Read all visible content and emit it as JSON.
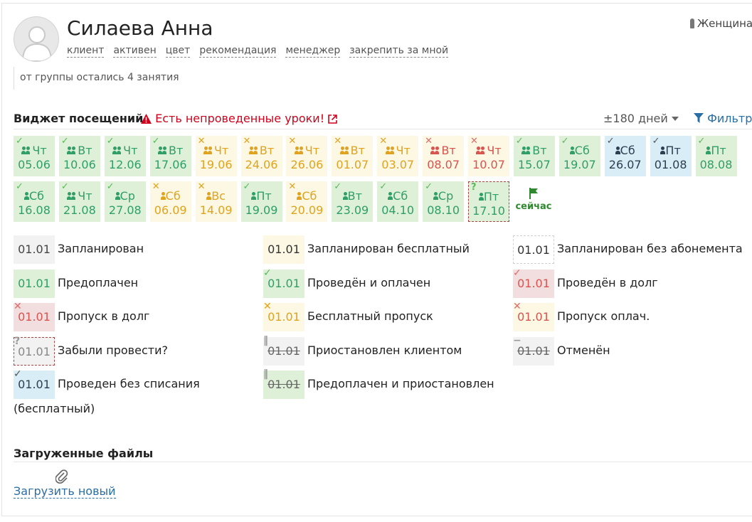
{
  "profile": {
    "name": "Силаева Анна",
    "gender": "Женщина",
    "tags": [
      "клиент",
      "активен",
      "цвет",
      "рекомендация",
      "менеджер",
      "закрепить за мной"
    ],
    "note": "от группы остались 4 занятия"
  },
  "widget": {
    "title": "Виджет посещений",
    "warning": "Есть непроведенные уроки!",
    "range": "±180 дней",
    "filter": "Фильтр"
  },
  "visits": [
    {
      "day": "Чт",
      "date": "05.06",
      "status": "paid",
      "mark": "check",
      "people": 2
    },
    {
      "day": "Вт",
      "date": "10.06",
      "status": "paid",
      "mark": "check",
      "people": 2
    },
    {
      "day": "Чт",
      "date": "12.06",
      "status": "paid",
      "mark": "check",
      "people": 2
    },
    {
      "day": "Вт",
      "date": "17.06",
      "status": "paid",
      "mark": "check",
      "people": 2
    },
    {
      "day": "Чт",
      "date": "19.06",
      "status": "free-skip",
      "mark": "cross",
      "people": 2
    },
    {
      "day": "Вт",
      "date": "24.06",
      "status": "free-skip",
      "mark": "cross",
      "people": 2
    },
    {
      "day": "Чт",
      "date": "26.06",
      "status": "free-skip",
      "mark": "cross",
      "people": 2
    },
    {
      "day": "Вт",
      "date": "01.07",
      "status": "free-skip",
      "mark": "cross",
      "people": 2
    },
    {
      "day": "Чт",
      "date": "03.07",
      "status": "free-skip",
      "mark": "cross",
      "people": 2
    },
    {
      "day": "Вт",
      "date": "08.07",
      "status": "skip-paid",
      "mark": "cross",
      "people": 2
    },
    {
      "day": "Чт",
      "date": "10.07",
      "status": "skip-paid",
      "mark": "cross",
      "people": 2
    },
    {
      "day": "Вт",
      "date": "15.07",
      "status": "paid",
      "mark": "check",
      "people": 2
    },
    {
      "day": "Сб",
      "date": "19.07",
      "status": "paid",
      "mark": "check",
      "people": 1
    },
    {
      "day": "Сб",
      "date": "26.07",
      "status": "no-charge",
      "mark": "check",
      "people": 1
    },
    {
      "day": "Пт",
      "date": "01.08",
      "status": "no-charge",
      "mark": "check",
      "people": 1
    },
    {
      "day": "Пт",
      "date": "08.08",
      "status": "paid",
      "mark": "check",
      "people": 1
    },
    {
      "day": "Сб",
      "date": "16.08",
      "status": "paid",
      "mark": "check",
      "people": 1
    },
    {
      "day": "Чт",
      "date": "21.08",
      "status": "paid",
      "mark": "check",
      "people": 2
    },
    {
      "day": "Ср",
      "date": "27.08",
      "status": "paid",
      "mark": "check",
      "people": 1
    },
    {
      "day": "Сб",
      "date": "06.09",
      "status": "free-skip",
      "mark": "cross",
      "people": 1
    },
    {
      "day": "Вс",
      "date": "14.09",
      "status": "free-skip",
      "mark": "cross",
      "people": 1
    },
    {
      "day": "Пт",
      "date": "19.09",
      "status": "paid",
      "mark": "check",
      "people": 1
    },
    {
      "day": "Сб",
      "date": "20.09",
      "status": "free-skip",
      "mark": "cross",
      "people": 1
    },
    {
      "day": "Вт",
      "date": "23.09",
      "status": "paid",
      "mark": "check",
      "people": 1
    },
    {
      "day": "Сб",
      "date": "04.10",
      "status": "paid",
      "mark": "check",
      "people": 1
    },
    {
      "day": "Ср",
      "date": "08.10",
      "status": "paid",
      "mark": "check",
      "people": 1
    },
    {
      "day": "Пт",
      "date": "17.10",
      "status": "forgot",
      "mark": "question",
      "people": 1
    }
  ],
  "now_label": "сейчас",
  "legend": [
    {
      "sample": "01.01",
      "label": "Запланирован",
      "style": "planned",
      "mark": ""
    },
    {
      "sample": "01.01",
      "label": "Запланирован бесплатный",
      "style": "planned-free",
      "mark": ""
    },
    {
      "sample": "01.01",
      "label": "Запланирован без абонемента",
      "style": "planned-nosub",
      "mark": ""
    },
    {
      "sample": "01.01",
      "label": "Предоплачен",
      "style": "prepaid",
      "mark": ""
    },
    {
      "sample": "01.01",
      "label": "Проведён и оплачен",
      "style": "done-paid",
      "mark": "check"
    },
    {
      "sample": "01.01",
      "label": "Проведён в долг",
      "style": "done-debt",
      "mark": "check"
    },
    {
      "sample": "01.01",
      "label": "Пропуск в долг",
      "style": "skip-debt",
      "mark": "cross"
    },
    {
      "sample": "01.01",
      "label": "Бесплатный пропуск",
      "style": "free-skip",
      "mark": "cross"
    },
    {
      "sample": "01.01",
      "label": "Пропуск оплач.",
      "style": "skip-paid",
      "mark": "cross"
    },
    {
      "sample": "01.01",
      "label": "Забыли провести?",
      "style": "forgot",
      "mark": "question"
    },
    {
      "sample": "01.01",
      "label": "Приостановлен клиентом",
      "style": "suspended",
      "mark": "pause"
    },
    {
      "sample": "01.01",
      "label": "Отменён",
      "style": "cancelled",
      "mark": "minus"
    },
    {
      "sample": "01.01",
      "label": "Проведен без списания",
      "style": "no-charge",
      "mark": "check"
    },
    {
      "sample": "01.01",
      "label": "Предоплачен и приостановлен",
      "style": "prepaid-suspended",
      "mark": "pause"
    }
  ],
  "legend_extra": "(бесплатный)",
  "files": {
    "title": "Загруженные файлы",
    "upload": "Загрузить новый"
  },
  "colors": {
    "paid": "#dff0d8",
    "free": "#fcf8e3",
    "debt": "#f2dede",
    "no_charge": "#d9edf7",
    "warning": "#d0021b",
    "link": "#2a6ea6"
  }
}
